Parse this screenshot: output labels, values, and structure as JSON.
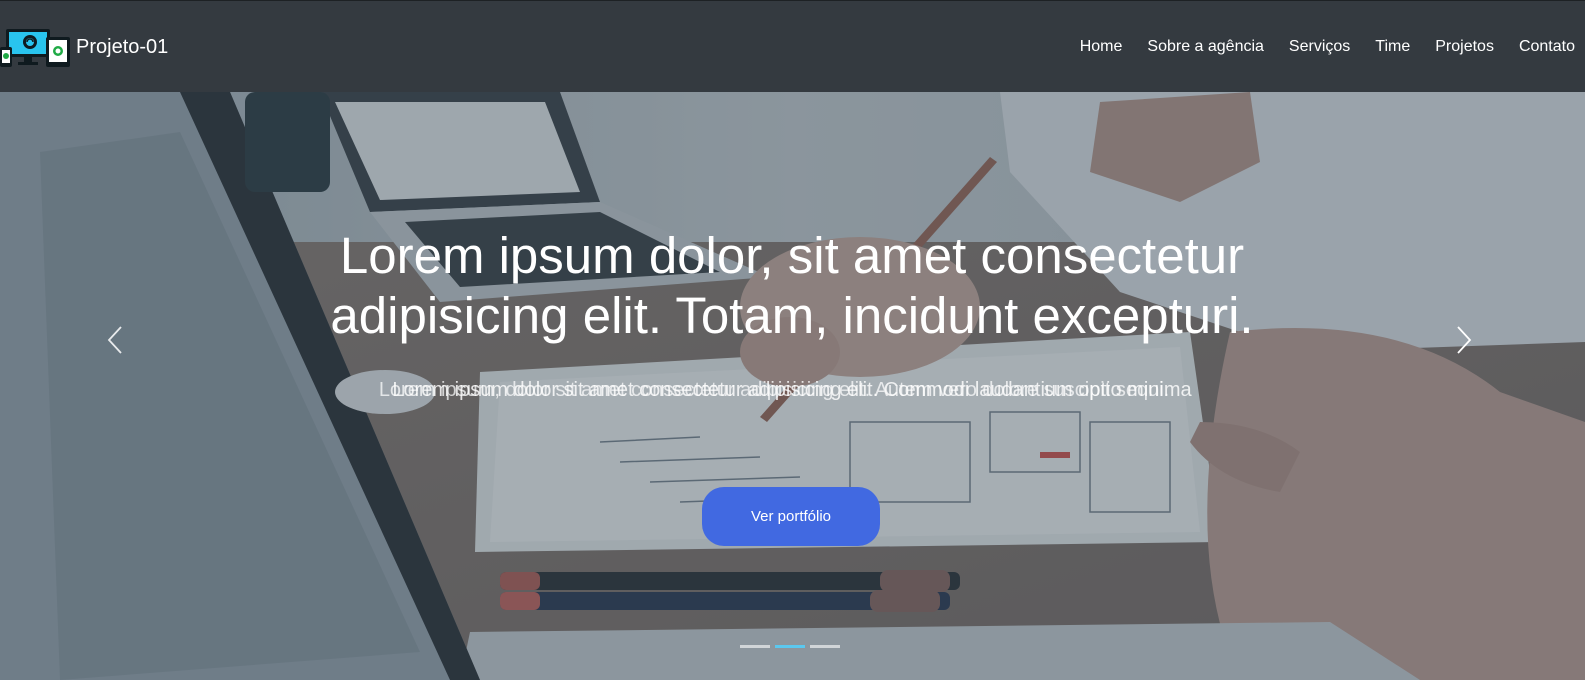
{
  "navbar": {
    "brand_name": "Projeto-01",
    "logo_icon": "responsive-devices-icon",
    "links": [
      {
        "label": "Home"
      },
      {
        "label": "Sobre a agência"
      },
      {
        "label": "Serviços"
      },
      {
        "label": "Time"
      },
      {
        "label": "Projetos"
      },
      {
        "label": "Contato"
      }
    ]
  },
  "hero": {
    "title": "Lorem ipsum dolor, sit amet consectetur adipisicing elit. Totam, incidunt excepturi.",
    "subtitle_layer_1": "Lorem ipsum dolor sit amet consectetur adipisicing elit. Commodi laudantium optio minima",
    "subtitle_layer_2": "Lorem ipsum, dolor sit amet consectetur adipisicing elit. Autem vero dolore suscipit sequi.",
    "cta_label": "Ver portfólio",
    "prev_icon": "chevron-left-icon",
    "next_icon": "chevron-right-icon",
    "slides_count": 3,
    "active_slide": 2
  },
  "colors": {
    "navbar_bg": "#343a40",
    "cta_bg": "#4169e1",
    "indicator_active": "#5bc8ef",
    "text": "#ffffff"
  }
}
